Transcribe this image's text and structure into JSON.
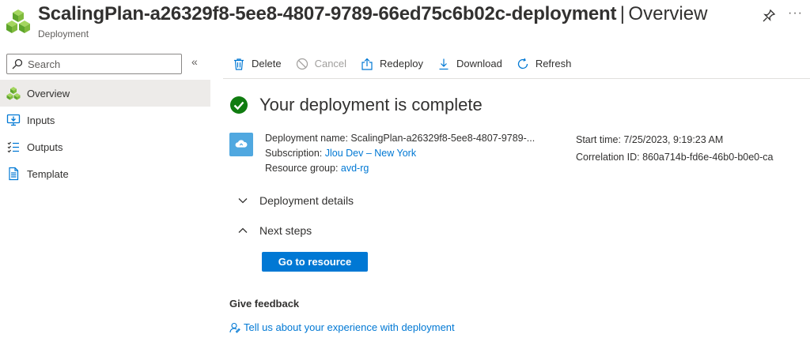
{
  "header": {
    "title": "ScalingPlan-a26329f8-5ee8-4807-9789-66ed75c6b02c-deployment",
    "separator": "|",
    "section": "Overview",
    "subtitle": "Deployment",
    "more": "···"
  },
  "sidebar": {
    "search_placeholder": "Search",
    "collapse": "«",
    "items": [
      {
        "label": "Overview",
        "icon": "overview-cubes-icon",
        "active": true
      },
      {
        "label": "Inputs",
        "icon": "inputs-icon",
        "active": false
      },
      {
        "label": "Outputs",
        "icon": "outputs-list-icon",
        "active": false
      },
      {
        "label": "Template",
        "icon": "template-document-icon",
        "active": false
      }
    ]
  },
  "toolbar": {
    "delete": "Delete",
    "cancel": "Cancel",
    "redeploy": "Redeploy",
    "download": "Download",
    "refresh": "Refresh"
  },
  "status": {
    "heading": "Your deployment is complete"
  },
  "details": {
    "deployment_name_label": "Deployment name:",
    "deployment_name_value": "ScalingPlan-a26329f8-5ee8-4807-9789-...",
    "subscription_label": "Subscription:",
    "subscription_value": "Jlou Dev – New York",
    "resource_group_label": "Resource group:",
    "resource_group_value": "avd-rg",
    "start_time_label": "Start time:",
    "start_time_value": "7/25/2023, 9:19:23 AM",
    "correlation_label": "Correlation ID:",
    "correlation_value": "860a714b-fd6e-46b0-b0e0-ca"
  },
  "sections": {
    "deployment_details": "Deployment details",
    "next_steps": "Next steps"
  },
  "actions": {
    "go_to_resource": "Go to resource"
  },
  "feedback": {
    "title": "Give feedback",
    "link": "Tell us about your experience with deployment"
  },
  "colors": {
    "accent": "#0078d4",
    "success": "#107c10",
    "nav_active_bg": "#edebe9"
  }
}
